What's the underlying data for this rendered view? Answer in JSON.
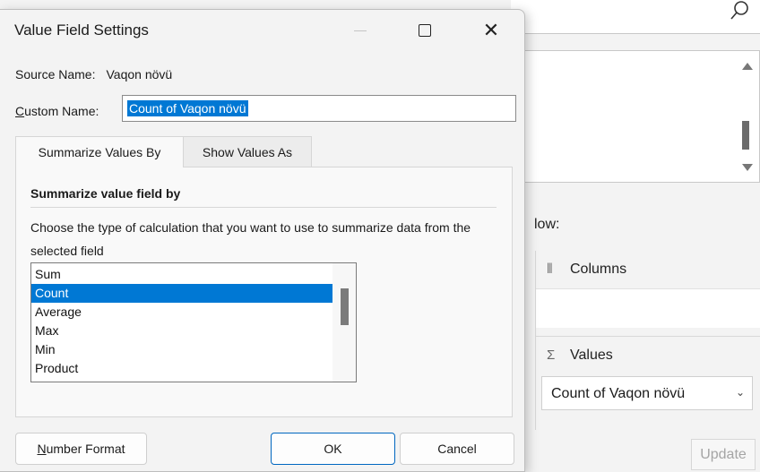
{
  "dialog": {
    "title": "Value Field Settings",
    "source_name_label": "Source Name:",
    "source_name_value": "Vaqon növü",
    "custom_name_label_rest": "ustom Name:",
    "custom_name_label_first": "C",
    "custom_name_value": "Count of Vaqon növü",
    "tabs": [
      {
        "label": "Summarize Values By",
        "active": true
      },
      {
        "label": "Show Values As",
        "active": false
      }
    ],
    "group_title": "Summarize value field by",
    "description": "Choose the type of calculation that you want to use to summarize data from the selected field",
    "functions": [
      "Sum",
      "Count",
      "Average",
      "Max",
      "Min",
      "Product"
    ],
    "selected_function": "Count",
    "buttons": {
      "number_format_first": "N",
      "number_format_rest": "umber Format",
      "ok": "OK",
      "cancel": "Cancel"
    }
  },
  "background_pane": {
    "drag_label_fragment": "low:",
    "columns_label": "Columns",
    "values_label": "Values",
    "sigma_symbol": "Σ",
    "values_field": "Count of Vaqon növü",
    "update_button": "Update"
  },
  "colors": {
    "selection": "#0078d4",
    "dialog_bg": "#f3f3f3",
    "ok_border": "#0067c0"
  }
}
